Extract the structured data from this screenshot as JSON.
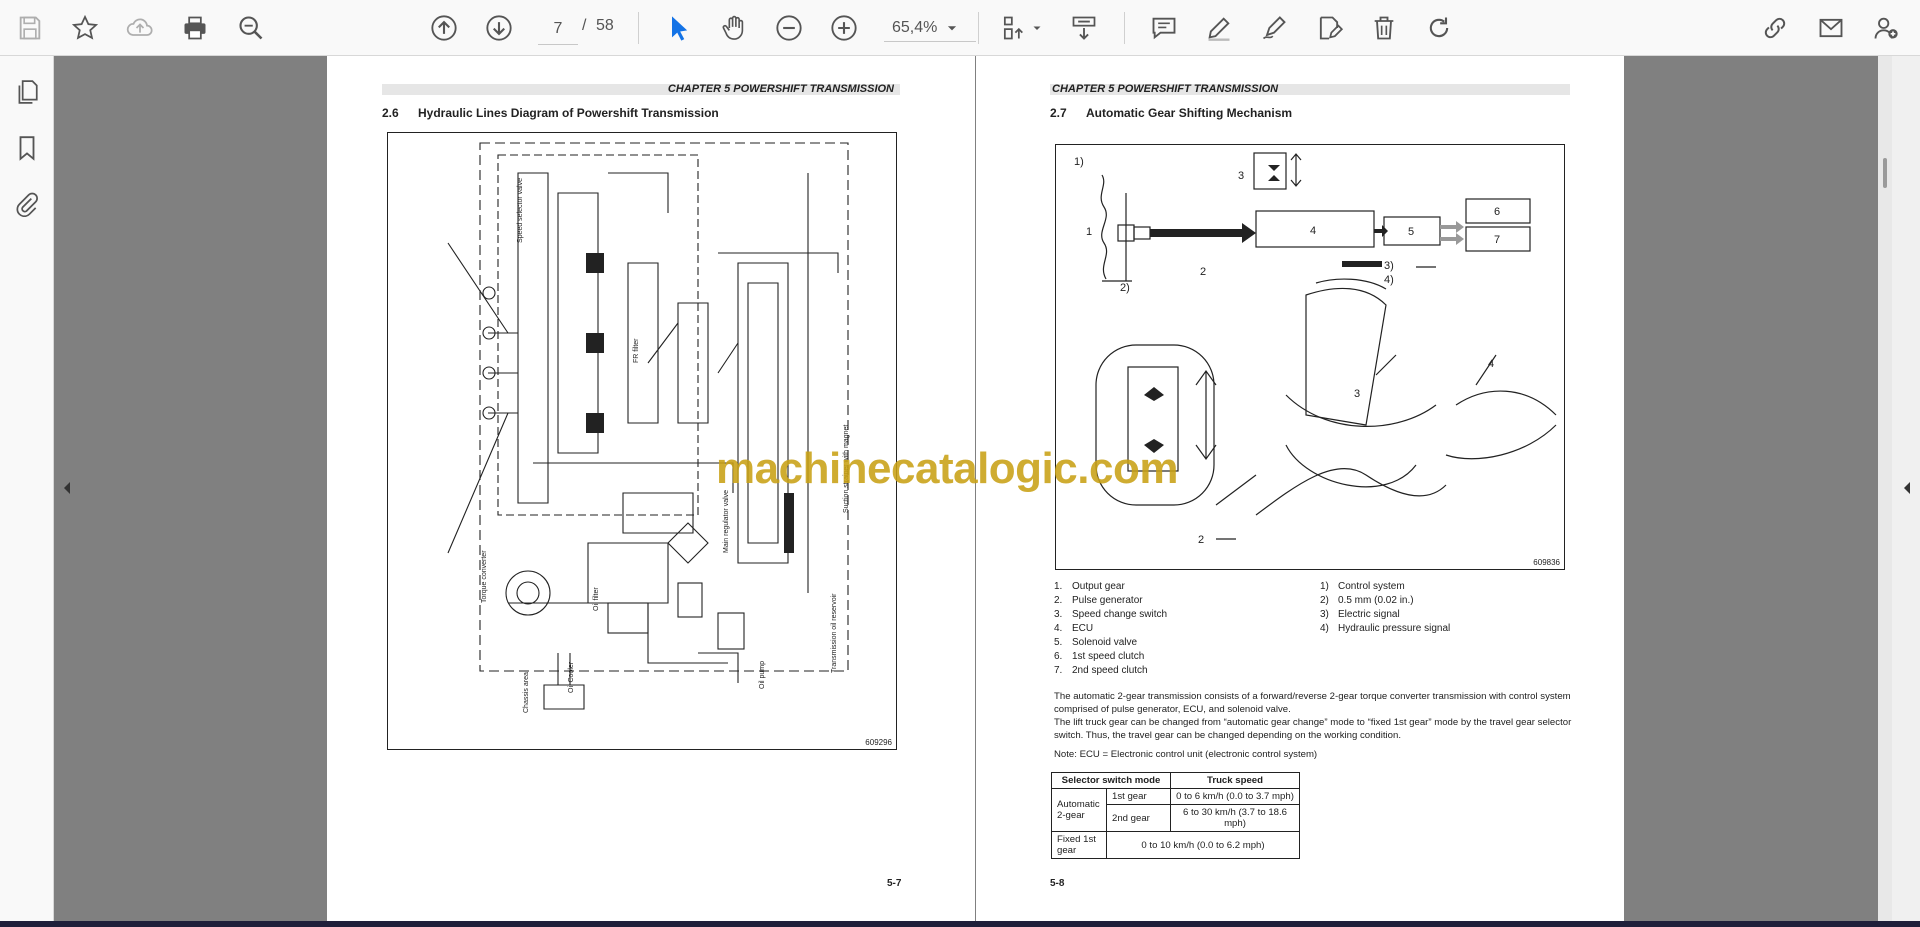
{
  "toolbar": {
    "page_current": "7",
    "page_separator": "/",
    "page_total": "58",
    "zoom_value": "65,4%"
  },
  "icons": {
    "save": "save-icon",
    "bookmark_star": "star-icon",
    "upload": "cloud-upload-icon",
    "print": "print-icon",
    "find": "zoom-search-icon",
    "prev": "arrow-up-circle-icon",
    "next": "arrow-down-circle-icon",
    "select": "cursor-icon",
    "hand": "hand-icon",
    "zoom_out": "minus-circle-icon",
    "zoom_in": "plus-circle-icon"
  },
  "colors": {
    "accent": "#1473e6",
    "toolbar_bg": "#f9f9f9",
    "doc_bg": "#808080",
    "watermark": "#c8a014"
  },
  "left_page": {
    "header": "CHAPTER 5 POWERSHIFT TRANSMISSION",
    "section_number": "2.6",
    "section_title": "Hydraulic Lines Diagram of Powershift Transmission",
    "figure_id": "609296",
    "page_number": "5-7"
  },
  "right_page": {
    "header": "CHAPTER 5 POWERSHIFT TRANSMISSION",
    "section_number": "2.7",
    "section_title": "Automatic Gear Shifting Mechanism",
    "figure_id": "609836",
    "legend_left": [
      {
        "k": "1.",
        "v": "Output gear"
      },
      {
        "k": "2.",
        "v": "Pulse generator"
      },
      {
        "k": "3.",
        "v": "Speed change switch"
      },
      {
        "k": "4.",
        "v": "ECU"
      },
      {
        "k": "5.",
        "v": "Solenoid valve"
      },
      {
        "k": "6.",
        "v": "1st speed clutch"
      },
      {
        "k": "7.",
        "v": "2nd speed clutch"
      }
    ],
    "legend_right": [
      {
        "k": "1)",
        "v": "Control system"
      },
      {
        "k": "2)",
        "v": "0.5 mm (0.02 in.)"
      },
      {
        "k": "3)",
        "v": "Electric signal"
      },
      {
        "k": "4)",
        "v": "Hydraulic pressure signal"
      }
    ],
    "paragraph_1": "The automatic 2-gear transmission consists of a forward/reverse 2-gear torque converter transmission with control system comprised of pulse generator, ECU, and solenoid valve.",
    "paragraph_2": "The lift truck gear can be changed from “automatic gear change” mode to “fixed 1st gear” mode by the travel gear selector switch. Thus, the travel gear can be changed depending on the working condition.",
    "note": "Note: ECU = Electronic control unit (electronic control system)",
    "table": {
      "h1": "Selector switch mode",
      "h2": "Truck speed",
      "r1_mode": "Automatic 2-gear",
      "r1_sub": "1st gear",
      "r1_speed": "0 to 6 km/h (0.0 to 3.7 mph)",
      "r2_sub": "2nd gear",
      "r2_speed": "6 to 30 km/h (3.7 to 18.6 mph)",
      "r3_mode": "Fixed 1st gear",
      "r3_speed": "0 to 10 km/h (0.0 to 6.2 mph)"
    },
    "page_number": "5-8"
  },
  "diagram_labels": {
    "b1": "1)",
    "n1": "1",
    "n2": "2",
    "b2": "2)",
    "n3": "3",
    "n4": "4",
    "n5": "5",
    "n6": "6",
    "n7": "7",
    "b3": "3)",
    "b4": "4)",
    "i2": "2",
    "i3": "3",
    "i4": "4"
  },
  "hydraulic_labels": {
    "torque_converter": "Torque converter",
    "oil_filter": "Oil filter",
    "oil_cooler": "Oil Cooler",
    "oil_pump": "Oil pump",
    "main_regulator": "Main regulator valve",
    "fr_filter": "FR filter",
    "speed_selector": "Speed selector valve",
    "chassis": "Chassis area",
    "suction": "Suction strainer with magnet",
    "transmission": "Transmission oil reservoir"
  },
  "watermark": "machinecatalogic.com"
}
